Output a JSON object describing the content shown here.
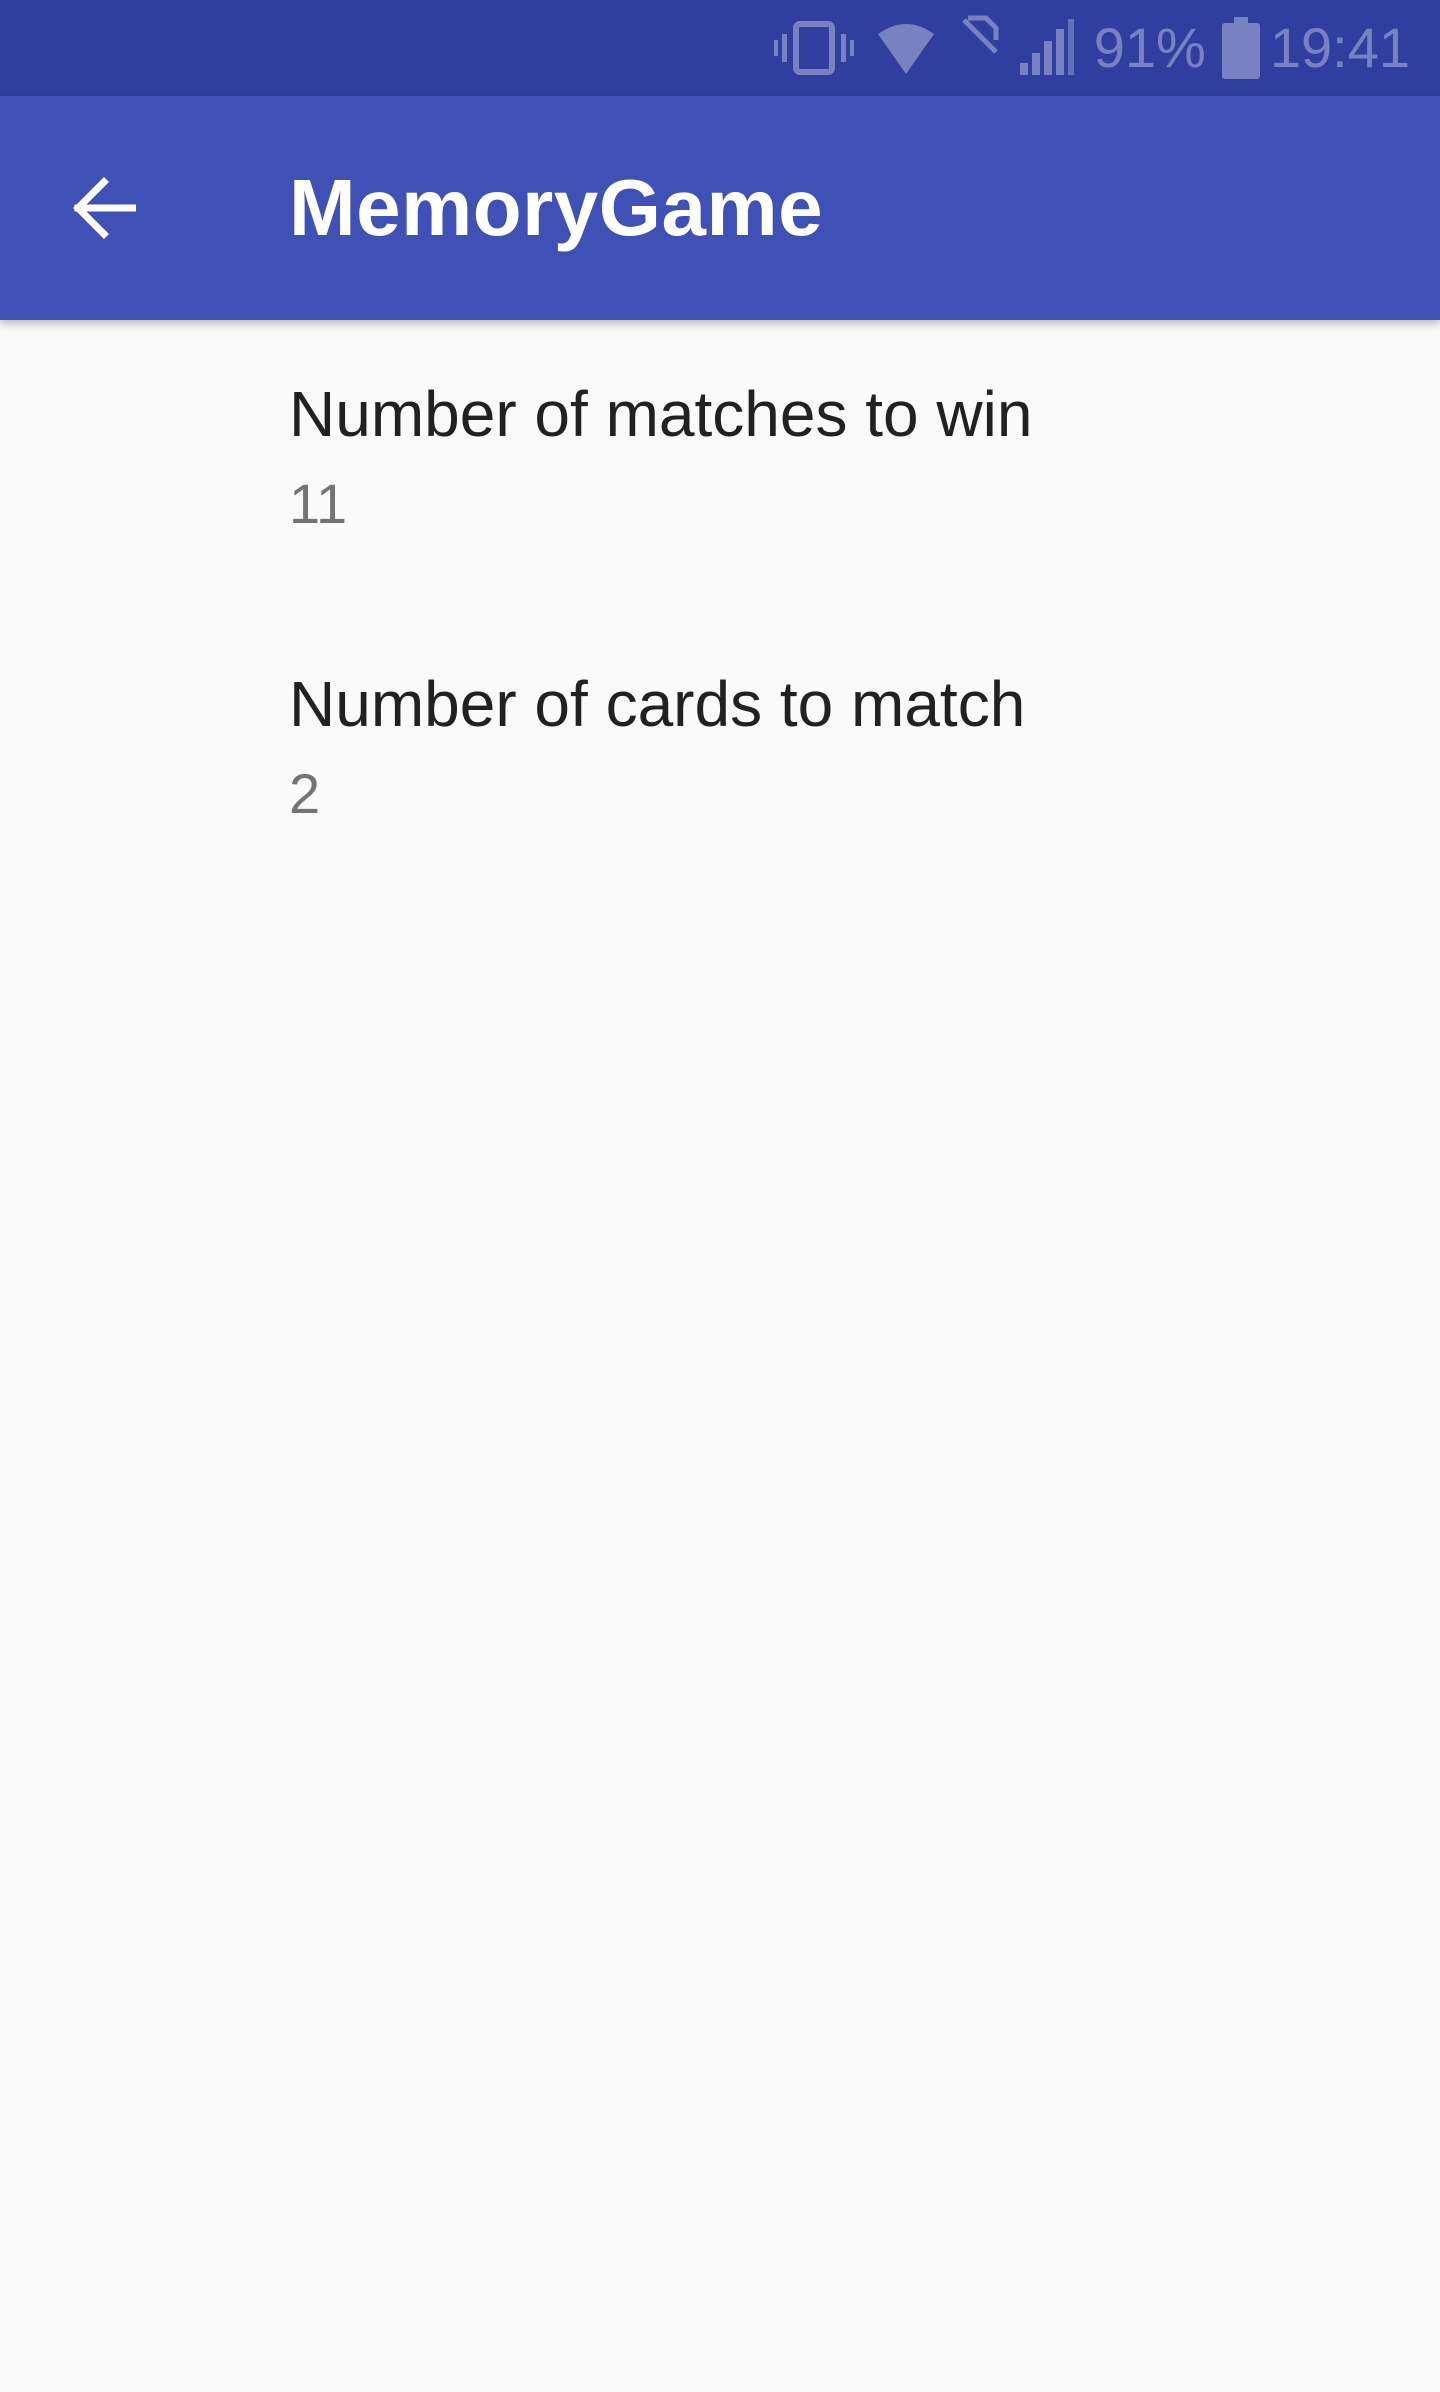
{
  "status_bar": {
    "battery_percent": "91%",
    "time": "19:41",
    "icons": [
      "vibrate-icon",
      "wifi-icon",
      "no-sim-icon",
      "signal-icon",
      "battery-icon"
    ]
  },
  "app_bar": {
    "title": "MemoryGame",
    "back_icon": "arrow-back-icon",
    "color": "#3f51b5",
    "status_color": "#303f9f"
  },
  "preferences": [
    {
      "title": "Number of matches to win",
      "summary": "11"
    },
    {
      "title": "Number of cards to match",
      "summary": "2"
    }
  ]
}
